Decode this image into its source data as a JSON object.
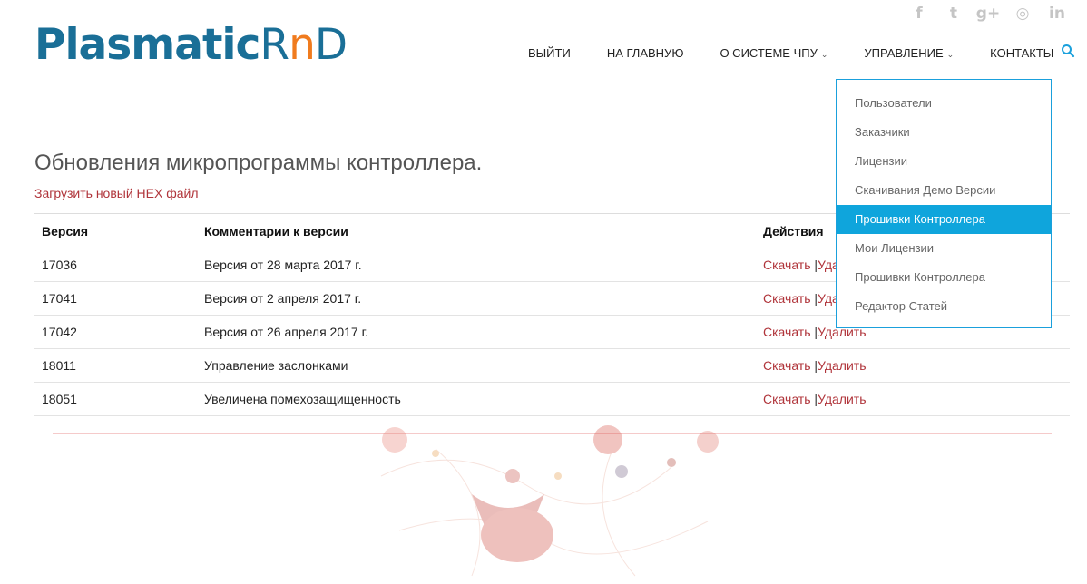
{
  "logo": {
    "plasmatic": "Plasmatic",
    "r": "R",
    "n": "n",
    "d": "D"
  },
  "social": [
    {
      "name": "facebook-icon",
      "glyph": "f"
    },
    {
      "name": "twitter-icon",
      "glyph": "t"
    },
    {
      "name": "google-plus-icon",
      "glyph": "g+"
    },
    {
      "name": "dribbble-icon",
      "glyph": "◎"
    },
    {
      "name": "linkedin-icon",
      "glyph": "in"
    }
  ],
  "nav": {
    "logout": "ВЫЙТИ",
    "home": "НА ГЛАВНУЮ",
    "about": "О СИСТЕМЕ ЧПУ",
    "manage": "УПРАВЛЕНИЕ",
    "contacts": "КОНТАКТЫ",
    "caret": "⌄"
  },
  "dropdown": {
    "items": [
      "Пользователи",
      "Заказчики",
      "Лицензии",
      "Скачивания Демо Версии",
      "Прошивки Контроллера",
      "Мои Лицензии",
      "Прошивки Контроллера",
      "Редактор Статей"
    ],
    "active_index": 4
  },
  "page": {
    "title": "Обновления микропрограммы контроллера.",
    "upload_link": "Загрузить новый HEX файл"
  },
  "table": {
    "headers": [
      "Версия",
      "Комментарии к версии",
      "Действия"
    ],
    "rows": [
      {
        "version": "17036",
        "comment": "Версия от 28 марта 2017 г.",
        "download": "Скачать",
        "sep": " |",
        "delete": "Удалить"
      },
      {
        "version": "17041",
        "comment": "Версия от 2 апреля 2017 г.",
        "download": "Скачать",
        "sep": " |",
        "delete": "Удалить"
      },
      {
        "version": "17042",
        "comment": "Версия от 26 апреля 2017 г.",
        "download": "Скачать",
        "sep": " |",
        "delete": "Удалить"
      },
      {
        "version": "18011",
        "comment": "Управление заслонками",
        "download": "Скачать",
        "sep": " |",
        "delete": "Удалить"
      },
      {
        "version": "18051",
        "comment": "Увеличена помехозащищенность",
        "download": "Скачать",
        "sep": " |",
        "delete": "Удалить"
      }
    ]
  },
  "colors": {
    "brand_blue": "#1a6f97",
    "brand_orange": "#f07b1e",
    "link_red": "#b0343a",
    "dropdown_active": "#0fa5dc"
  }
}
